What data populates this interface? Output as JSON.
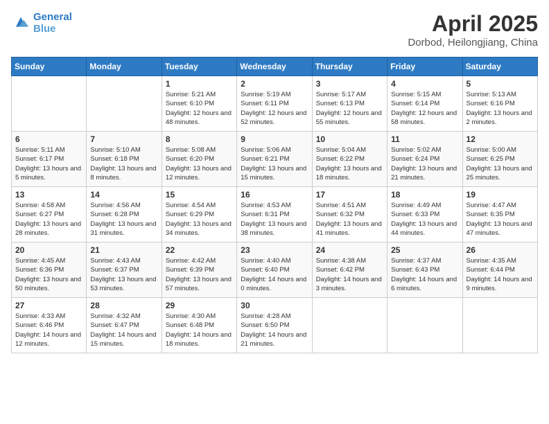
{
  "header": {
    "logo_line1": "General",
    "logo_line2": "Blue",
    "month": "April 2025",
    "location": "Dorbod, Heilongjiang, China"
  },
  "days_of_week": [
    "Sunday",
    "Monday",
    "Tuesday",
    "Wednesday",
    "Thursday",
    "Friday",
    "Saturday"
  ],
  "weeks": [
    [
      {
        "day": "",
        "info": ""
      },
      {
        "day": "",
        "info": ""
      },
      {
        "day": "1",
        "info": "Sunrise: 5:21 AM\nSunset: 6:10 PM\nDaylight: 12 hours and 48 minutes."
      },
      {
        "day": "2",
        "info": "Sunrise: 5:19 AM\nSunset: 6:11 PM\nDaylight: 12 hours and 52 minutes."
      },
      {
        "day": "3",
        "info": "Sunrise: 5:17 AM\nSunset: 6:13 PM\nDaylight: 12 hours and 55 minutes."
      },
      {
        "day": "4",
        "info": "Sunrise: 5:15 AM\nSunset: 6:14 PM\nDaylight: 12 hours and 58 minutes."
      },
      {
        "day": "5",
        "info": "Sunrise: 5:13 AM\nSunset: 6:16 PM\nDaylight: 13 hours and 2 minutes."
      }
    ],
    [
      {
        "day": "6",
        "info": "Sunrise: 5:11 AM\nSunset: 6:17 PM\nDaylight: 13 hours and 5 minutes."
      },
      {
        "day": "7",
        "info": "Sunrise: 5:10 AM\nSunset: 6:18 PM\nDaylight: 13 hours and 8 minutes."
      },
      {
        "day": "8",
        "info": "Sunrise: 5:08 AM\nSunset: 6:20 PM\nDaylight: 13 hours and 12 minutes."
      },
      {
        "day": "9",
        "info": "Sunrise: 5:06 AM\nSunset: 6:21 PM\nDaylight: 13 hours and 15 minutes."
      },
      {
        "day": "10",
        "info": "Sunrise: 5:04 AM\nSunset: 6:22 PM\nDaylight: 13 hours and 18 minutes."
      },
      {
        "day": "11",
        "info": "Sunrise: 5:02 AM\nSunset: 6:24 PM\nDaylight: 13 hours and 21 minutes."
      },
      {
        "day": "12",
        "info": "Sunrise: 5:00 AM\nSunset: 6:25 PM\nDaylight: 13 hours and 25 minutes."
      }
    ],
    [
      {
        "day": "13",
        "info": "Sunrise: 4:58 AM\nSunset: 6:27 PM\nDaylight: 13 hours and 28 minutes."
      },
      {
        "day": "14",
        "info": "Sunrise: 4:56 AM\nSunset: 6:28 PM\nDaylight: 13 hours and 31 minutes."
      },
      {
        "day": "15",
        "info": "Sunrise: 4:54 AM\nSunset: 6:29 PM\nDaylight: 13 hours and 34 minutes."
      },
      {
        "day": "16",
        "info": "Sunrise: 4:53 AM\nSunset: 6:31 PM\nDaylight: 13 hours and 38 minutes."
      },
      {
        "day": "17",
        "info": "Sunrise: 4:51 AM\nSunset: 6:32 PM\nDaylight: 13 hours and 41 minutes."
      },
      {
        "day": "18",
        "info": "Sunrise: 4:49 AM\nSunset: 6:33 PM\nDaylight: 13 hours and 44 minutes."
      },
      {
        "day": "19",
        "info": "Sunrise: 4:47 AM\nSunset: 6:35 PM\nDaylight: 13 hours and 47 minutes."
      }
    ],
    [
      {
        "day": "20",
        "info": "Sunrise: 4:45 AM\nSunset: 6:36 PM\nDaylight: 13 hours and 50 minutes."
      },
      {
        "day": "21",
        "info": "Sunrise: 4:43 AM\nSunset: 6:37 PM\nDaylight: 13 hours and 53 minutes."
      },
      {
        "day": "22",
        "info": "Sunrise: 4:42 AM\nSunset: 6:39 PM\nDaylight: 13 hours and 57 minutes."
      },
      {
        "day": "23",
        "info": "Sunrise: 4:40 AM\nSunset: 6:40 PM\nDaylight: 14 hours and 0 minutes."
      },
      {
        "day": "24",
        "info": "Sunrise: 4:38 AM\nSunset: 6:42 PM\nDaylight: 14 hours and 3 minutes."
      },
      {
        "day": "25",
        "info": "Sunrise: 4:37 AM\nSunset: 6:43 PM\nDaylight: 14 hours and 6 minutes."
      },
      {
        "day": "26",
        "info": "Sunrise: 4:35 AM\nSunset: 6:44 PM\nDaylight: 14 hours and 9 minutes."
      }
    ],
    [
      {
        "day": "27",
        "info": "Sunrise: 4:33 AM\nSunset: 6:46 PM\nDaylight: 14 hours and 12 minutes."
      },
      {
        "day": "28",
        "info": "Sunrise: 4:32 AM\nSunset: 6:47 PM\nDaylight: 14 hours and 15 minutes."
      },
      {
        "day": "29",
        "info": "Sunrise: 4:30 AM\nSunset: 6:48 PM\nDaylight: 14 hours and 18 minutes."
      },
      {
        "day": "30",
        "info": "Sunrise: 4:28 AM\nSunset: 6:50 PM\nDaylight: 14 hours and 21 minutes."
      },
      {
        "day": "",
        "info": ""
      },
      {
        "day": "",
        "info": ""
      },
      {
        "day": "",
        "info": ""
      }
    ]
  ]
}
